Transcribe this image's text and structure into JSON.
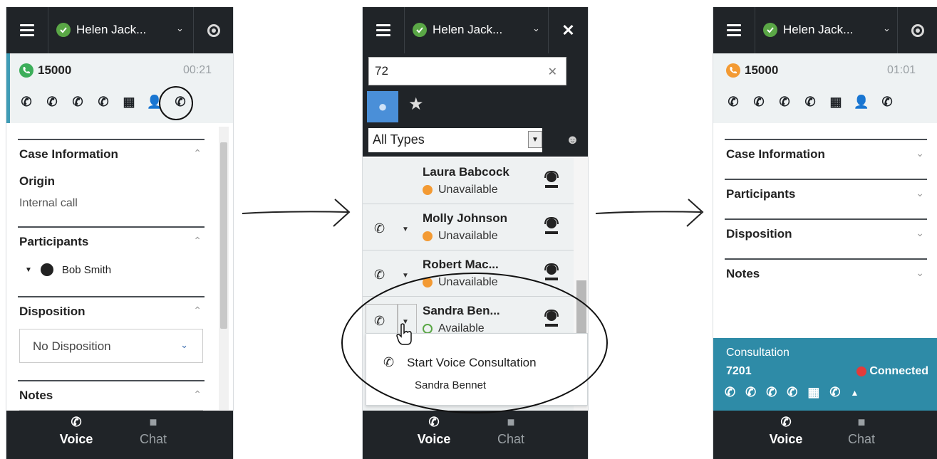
{
  "agent": {
    "name": "Helen Jack..."
  },
  "panel1": {
    "call": {
      "number": "15000",
      "time": "00:21"
    },
    "sections": {
      "case_info": {
        "title": "Case Information",
        "origin_label": "Origin",
        "origin_value": "Internal call"
      },
      "participants": {
        "title": "Participants",
        "member": "Bob Smith"
      },
      "disposition": {
        "title": "Disposition",
        "value": "No Disposition"
      },
      "notes": {
        "title": "Notes"
      }
    },
    "tabs": {
      "voice": "Voice",
      "chat": "Chat"
    }
  },
  "panel2": {
    "search": {
      "value": "72"
    },
    "type_filter": "All Types",
    "contacts": [
      {
        "name": "Laura Babcock",
        "status": "Unavailable"
      },
      {
        "name": "Molly Johnson",
        "status": "Unavailable"
      },
      {
        "name": "Robert Mac...",
        "status": "Unavailable"
      },
      {
        "name": "Sandra Ben...",
        "status": "Available"
      }
    ],
    "menu": {
      "action": "Start Voice Consultation",
      "target": "Sandra Bennet"
    },
    "tabs": {
      "voice": "Voice",
      "chat": "Chat"
    }
  },
  "panel3": {
    "call": {
      "number": "15000",
      "time": "01:01"
    },
    "sections": [
      "Case Information",
      "Participants",
      "Disposition",
      "Notes"
    ],
    "consultation": {
      "label": "Consultation",
      "number": "7201",
      "status": "Connected"
    },
    "tabs": {
      "voice": "Voice",
      "chat": "Chat"
    }
  },
  "colors": {
    "topbar": "#202428",
    "accent_blue": "#3f9cb6",
    "consult_bg": "#2e8ba7",
    "available_green": "#5aa746",
    "unavailable_orange": "#f39a33",
    "connected_red": "#e23b3b"
  }
}
